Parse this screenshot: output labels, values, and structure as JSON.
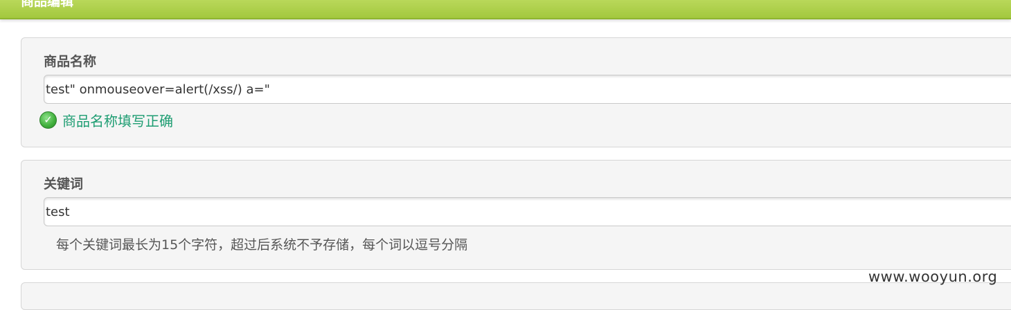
{
  "header": {
    "title": "商品编辑",
    "accent": "#a8cc42"
  },
  "fields": {
    "name": {
      "label": "商品名称",
      "value": "test\" onmouseover=alert(/xss/) a=\"",
      "validation_text": "商品名称填写正确",
      "validation_icon": "check-circle-icon",
      "validation_color": "#1e9d72"
    },
    "keywords": {
      "label": "关键词",
      "value": "test",
      "hint": "每个关键词最长为15个字符，超过后系统不予存储，每个词以逗号分隔"
    }
  },
  "watermark": "www.wooyun.org"
}
